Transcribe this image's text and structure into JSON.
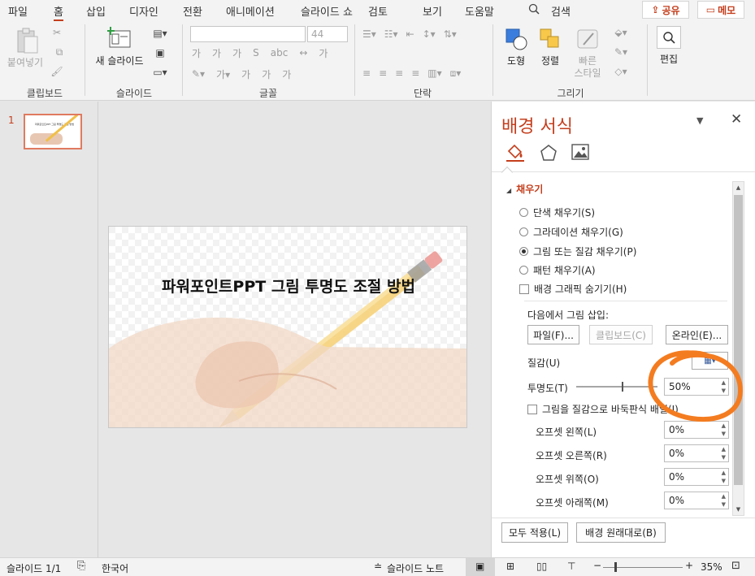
{
  "menu": {
    "tabs": [
      "파일",
      "홈",
      "삽입",
      "디자인",
      "전환",
      "애니메이션",
      "슬라이드 쇼",
      "검토",
      "보기",
      "도움말"
    ],
    "search": "검색",
    "share": "공유",
    "comments": "메모"
  },
  "ribbon": {
    "clipboard": {
      "paste": "붙여넣기",
      "label": "클립보드"
    },
    "slides": {
      "new_slide": "새 슬라이드",
      "label": "슬라이드"
    },
    "font": {
      "size": "44",
      "label": "글꼴"
    },
    "paragraph": {
      "label": "단락"
    },
    "drawing": {
      "shape": "도형",
      "arrange": "정렬",
      "quick_style_1": "빠른",
      "quick_style_2": "스타일",
      "label": "그리기"
    },
    "editing": {
      "edit": "편집"
    }
  },
  "thumbnails": [
    {
      "number": "1",
      "caption": "파워포인트PPT 그림 투명도 조절 방법"
    }
  ],
  "slide": {
    "title": "파워포인트PPT 그림 투명도 조절 방법"
  },
  "format_pane": {
    "title": "배경 서식",
    "section": "채우기",
    "fill_options": [
      {
        "label": "단색 채우기(S)",
        "selected": false
      },
      {
        "label": "그라데이션 채우기(G)",
        "selected": false
      },
      {
        "label": "그림 또는 질감 채우기(P)",
        "selected": true
      },
      {
        "label": "패턴 채우기(A)",
        "selected": false
      }
    ],
    "hide_graphics": "배경 그래픽 숨기기(H)",
    "insert_from": "다음에서 그림 삽입:",
    "file_btn": "파일(F)...",
    "clipboard_btn": "클립보드(C)",
    "online_btn": "온라인(E)...",
    "texture": "질감(U)",
    "transparency_label": "투명도(T)",
    "transparency_value": "50%",
    "transparency_fraction": 0.5,
    "tile_label": "그림을 질감으로 바둑판식 배열(I)",
    "offsets": [
      {
        "label": "오프셋 왼쪽(L)",
        "value": "0%"
      },
      {
        "label": "오프셋 오른쪽(R)",
        "value": "0%"
      },
      {
        "label": "오프셋 위쪽(O)",
        "value": "0%"
      },
      {
        "label": "오프셋 아래쪽(M)",
        "value": "0%"
      }
    ],
    "apply_all": "모두 적용(L)",
    "reset": "배경 원래대로(B)"
  },
  "status": {
    "slide": "슬라이드 1/1",
    "language": "한국어",
    "notes": "슬라이드 노트",
    "zoom": "35%"
  },
  "colors": {
    "accent": "#c43e1c",
    "highlight_circle": "#f47c20"
  }
}
